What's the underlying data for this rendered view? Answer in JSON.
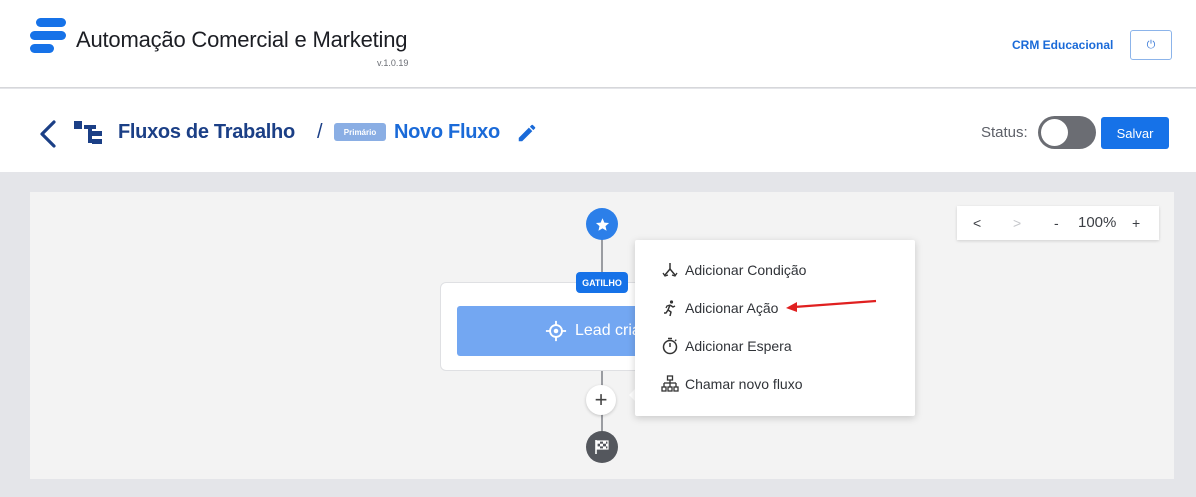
{
  "header": {
    "app_title": "Automação Comercial e Marketing",
    "version": "v.1.0.19",
    "crm_link": "CRM Educacional",
    "power_icon": "⏻",
    "brand_color": "#1672e8"
  },
  "subheader": {
    "breadcrumb_title": "Fluxos de Trabalho",
    "separator": "/",
    "badge": "Primário",
    "flow_name": "Novo Fluxo",
    "status_label": "Status:",
    "status_on": false,
    "save_label": "Salvar"
  },
  "zoom": {
    "prev": "<",
    "next": ">",
    "minus": "-",
    "value": "100%",
    "plus": "+"
  },
  "flow": {
    "trigger_tag": "GATILHO",
    "trigger_label": "Lead criado",
    "plus_symbol": "+"
  },
  "menu": {
    "items": [
      {
        "label": "Adicionar Condição",
        "icon": "split-icon"
      },
      {
        "label": "Adicionar Ação",
        "icon": "running-person-icon"
      },
      {
        "label": "Adicionar Espera",
        "icon": "stopwatch-icon"
      },
      {
        "label": "Chamar novo fluxo",
        "icon": "sitemap-icon"
      }
    ]
  }
}
